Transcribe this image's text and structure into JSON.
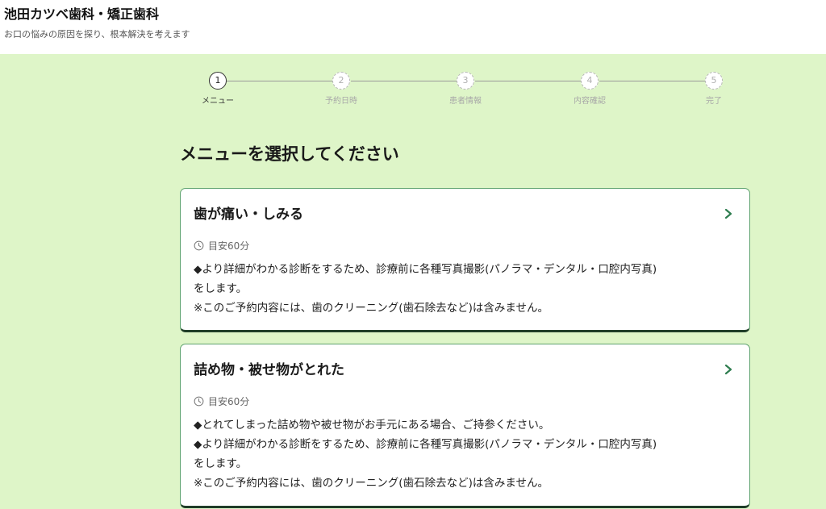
{
  "header": {
    "title": "池田カツベ歯科・矯正歯科",
    "subtitle": "お口の悩みの原因を探り、根本解決を考えます"
  },
  "stepper": {
    "steps": [
      {
        "number": "1",
        "label": "メニュー",
        "state": "active"
      },
      {
        "number": "2",
        "label": "予約日時",
        "state": "inactive"
      },
      {
        "number": "3",
        "label": "患者情報",
        "state": "inactive"
      },
      {
        "number": "4",
        "label": "内容確認",
        "state": "inactive"
      },
      {
        "number": "5",
        "label": "完了",
        "state": "inactive"
      }
    ]
  },
  "page": {
    "heading": "メニューを選択してください"
  },
  "menus": [
    {
      "title": "歯が痛い・しみる",
      "duration": "目安60分",
      "lines": [
        "◆より詳細がわかる診断をするため、診療前に各種写真撮影(パノラマ・デンタル・口腔内写真)",
        "をします。",
        "※このご予約内容には、歯のクリーニング(歯石除去など)は含みません。"
      ]
    },
    {
      "title": "詰め物・被せ物がとれた",
      "duration": "目安60分",
      "lines": [
        "◆とれてしまった詰め物や被せ物がお手元にある場合、ご持参ください。",
        "◆より詳細がわかる診断をするため、診療前に各種写真撮影(パノラマ・デンタル・口腔内写真)",
        "をします。",
        "※このご予約内容には、歯のクリーニング(歯石除去など)は含みません。"
      ]
    }
  ],
  "colors": {
    "background": "#def5c8",
    "card_border": "#5fa36f",
    "card_shadow": "#1f3d28",
    "chevron": "#2e7d4f"
  },
  "icons": {
    "duration": "clock-icon",
    "card_action": "chevron-right-icon"
  }
}
